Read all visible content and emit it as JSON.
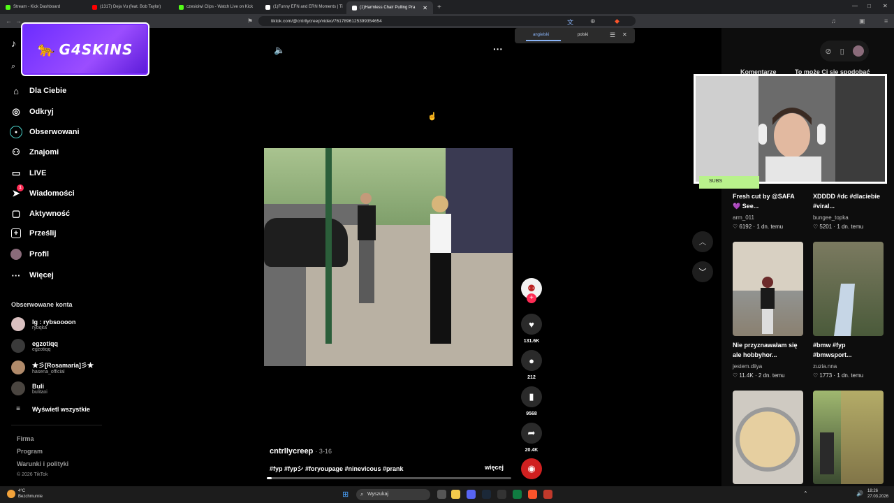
{
  "browser": {
    "tabs": [
      {
        "title": "Stream - Kick Dashboard",
        "color": "#53fc18"
      },
      {
        "title": "(1317) Deja Vu (feat. Bob Taylor)",
        "color": "#ff0000"
      },
      {
        "title": "czesioiwi Clips - Watch Live on Kick",
        "color": "#53fc18"
      },
      {
        "title": "(1)Funny EFN and ERN Moments | Ti",
        "color": "#ffffff"
      },
      {
        "title": "(1)Harmless Chair Pulling Pra",
        "color": "#ffffff"
      }
    ],
    "url": "tiktok.com/@cntrllycreep/video/7617896125399354654"
  },
  "translate": {
    "lang1": "angielski",
    "lang2": "polski"
  },
  "logo": {
    "text": "G4SKINS"
  },
  "sidebar": {
    "nav": [
      {
        "label": "Dla Ciebie",
        "icon": "home-icon"
      },
      {
        "label": "Odkryj",
        "icon": "compass-icon"
      },
      {
        "label": "Obserwowani",
        "icon": "following-icon"
      },
      {
        "label": "Znajomi",
        "icon": "friends-icon"
      },
      {
        "label": "LIVE",
        "icon": "live-icon"
      },
      {
        "label": "Wiadomości",
        "icon": "messages-icon",
        "badge": "1"
      },
      {
        "label": "Aktywność",
        "icon": "activity-icon"
      },
      {
        "label": "Prześlij",
        "icon": "upload-icon"
      },
      {
        "label": "Profil",
        "icon": "profile-icon"
      },
      {
        "label": "Więcej",
        "icon": "more-icon"
      }
    ],
    "followed_title": "Obserwowane konta",
    "followed": [
      {
        "name": "Ig : rybsoooon",
        "handle": "rybqka"
      },
      {
        "name": "egzotiqq",
        "handle": "egzotiqq"
      },
      {
        "name": "★彡[Rosamaria]彡★",
        "handle": "hasena_official"
      },
      {
        "name": "Buli",
        "handle": "bulitaxi"
      }
    ],
    "see_all": "Wyświetl wszystkie",
    "footer": [
      "Firma",
      "Program",
      "Warunki i polityki"
    ],
    "copyright": "© 2026 TikTok"
  },
  "video": {
    "author": "cntrllycreep",
    "date": "· 3-16",
    "hashtags": "#fyp #fypシ #foryoupage #ninevicous #prank",
    "more": "więcej",
    "likes": "131.6K",
    "comments": "212",
    "saves": "9568",
    "shares": "20.4K",
    "progress": 0.02
  },
  "right": {
    "tab1": "Komentarze",
    "tab2": "To może Ci się spodobać",
    "cards": [
      {
        "title": "Fresh cut by @SAFA 💜 See...",
        "user": "arm_011",
        "likes": "6192",
        "age": "1 dn. temu"
      },
      {
        "title": "XDDDD #dc #dlaciebie #viral...",
        "user": "bungee_topka",
        "likes": "5201",
        "age": "1 dn. temu"
      },
      {
        "title": "Nie przyznawałam się ale hobbyhor...",
        "user": "jestem.diiya",
        "likes": "11.4K",
        "age": "2 dn. temu"
      },
      {
        "title": "#bmw #fyp #bmwsport...",
        "user": "zuzia.nna",
        "likes": "1773",
        "age": "1 dn. temu"
      }
    ]
  },
  "webcam": {
    "label": "SUBS"
  },
  "taskbar": {
    "weather_temp": "4°C",
    "weather_desc": "Bezchmurnie",
    "search": "Wyszukaj",
    "time": "18:26",
    "date": "27.03.2026"
  }
}
